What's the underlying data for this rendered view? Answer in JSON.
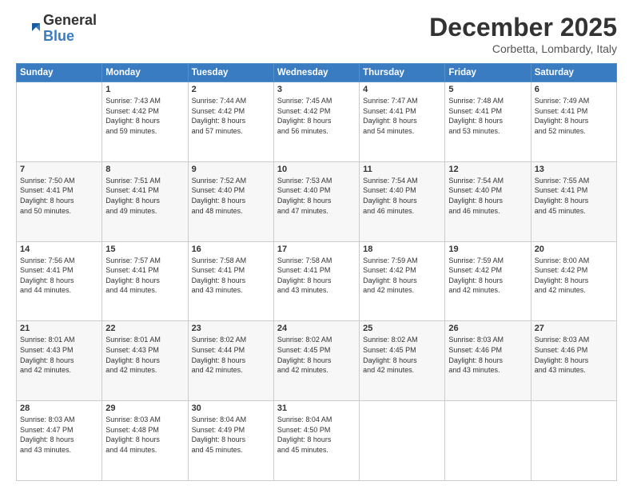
{
  "header": {
    "logo_general": "General",
    "logo_blue": "Blue",
    "month_title": "December 2025",
    "location": "Corbetta, Lombardy, Italy"
  },
  "days_of_week": [
    "Sunday",
    "Monday",
    "Tuesday",
    "Wednesday",
    "Thursday",
    "Friday",
    "Saturday"
  ],
  "weeks": [
    [
      {
        "day": "",
        "content": ""
      },
      {
        "day": "1",
        "content": "Sunrise: 7:43 AM\nSunset: 4:42 PM\nDaylight: 8 hours\nand 59 minutes."
      },
      {
        "day": "2",
        "content": "Sunrise: 7:44 AM\nSunset: 4:42 PM\nDaylight: 8 hours\nand 57 minutes."
      },
      {
        "day": "3",
        "content": "Sunrise: 7:45 AM\nSunset: 4:42 PM\nDaylight: 8 hours\nand 56 minutes."
      },
      {
        "day": "4",
        "content": "Sunrise: 7:47 AM\nSunset: 4:41 PM\nDaylight: 8 hours\nand 54 minutes."
      },
      {
        "day": "5",
        "content": "Sunrise: 7:48 AM\nSunset: 4:41 PM\nDaylight: 8 hours\nand 53 minutes."
      },
      {
        "day": "6",
        "content": "Sunrise: 7:49 AM\nSunset: 4:41 PM\nDaylight: 8 hours\nand 52 minutes."
      }
    ],
    [
      {
        "day": "7",
        "content": "Sunrise: 7:50 AM\nSunset: 4:41 PM\nDaylight: 8 hours\nand 50 minutes."
      },
      {
        "day": "8",
        "content": "Sunrise: 7:51 AM\nSunset: 4:41 PM\nDaylight: 8 hours\nand 49 minutes."
      },
      {
        "day": "9",
        "content": "Sunrise: 7:52 AM\nSunset: 4:40 PM\nDaylight: 8 hours\nand 48 minutes."
      },
      {
        "day": "10",
        "content": "Sunrise: 7:53 AM\nSunset: 4:40 PM\nDaylight: 8 hours\nand 47 minutes."
      },
      {
        "day": "11",
        "content": "Sunrise: 7:54 AM\nSunset: 4:40 PM\nDaylight: 8 hours\nand 46 minutes."
      },
      {
        "day": "12",
        "content": "Sunrise: 7:54 AM\nSunset: 4:40 PM\nDaylight: 8 hours\nand 46 minutes."
      },
      {
        "day": "13",
        "content": "Sunrise: 7:55 AM\nSunset: 4:41 PM\nDaylight: 8 hours\nand 45 minutes."
      }
    ],
    [
      {
        "day": "14",
        "content": "Sunrise: 7:56 AM\nSunset: 4:41 PM\nDaylight: 8 hours\nand 44 minutes."
      },
      {
        "day": "15",
        "content": "Sunrise: 7:57 AM\nSunset: 4:41 PM\nDaylight: 8 hours\nand 44 minutes."
      },
      {
        "day": "16",
        "content": "Sunrise: 7:58 AM\nSunset: 4:41 PM\nDaylight: 8 hours\nand 43 minutes."
      },
      {
        "day": "17",
        "content": "Sunrise: 7:58 AM\nSunset: 4:41 PM\nDaylight: 8 hours\nand 43 minutes."
      },
      {
        "day": "18",
        "content": "Sunrise: 7:59 AM\nSunset: 4:42 PM\nDaylight: 8 hours\nand 42 minutes."
      },
      {
        "day": "19",
        "content": "Sunrise: 7:59 AM\nSunset: 4:42 PM\nDaylight: 8 hours\nand 42 minutes."
      },
      {
        "day": "20",
        "content": "Sunrise: 8:00 AM\nSunset: 4:42 PM\nDaylight: 8 hours\nand 42 minutes."
      }
    ],
    [
      {
        "day": "21",
        "content": "Sunrise: 8:01 AM\nSunset: 4:43 PM\nDaylight: 8 hours\nand 42 minutes."
      },
      {
        "day": "22",
        "content": "Sunrise: 8:01 AM\nSunset: 4:43 PM\nDaylight: 8 hours\nand 42 minutes."
      },
      {
        "day": "23",
        "content": "Sunrise: 8:02 AM\nSunset: 4:44 PM\nDaylight: 8 hours\nand 42 minutes."
      },
      {
        "day": "24",
        "content": "Sunrise: 8:02 AM\nSunset: 4:45 PM\nDaylight: 8 hours\nand 42 minutes."
      },
      {
        "day": "25",
        "content": "Sunrise: 8:02 AM\nSunset: 4:45 PM\nDaylight: 8 hours\nand 42 minutes."
      },
      {
        "day": "26",
        "content": "Sunrise: 8:03 AM\nSunset: 4:46 PM\nDaylight: 8 hours\nand 43 minutes."
      },
      {
        "day": "27",
        "content": "Sunrise: 8:03 AM\nSunset: 4:46 PM\nDaylight: 8 hours\nand 43 minutes."
      }
    ],
    [
      {
        "day": "28",
        "content": "Sunrise: 8:03 AM\nSunset: 4:47 PM\nDaylight: 8 hours\nand 43 minutes."
      },
      {
        "day": "29",
        "content": "Sunrise: 8:03 AM\nSunset: 4:48 PM\nDaylight: 8 hours\nand 44 minutes."
      },
      {
        "day": "30",
        "content": "Sunrise: 8:04 AM\nSunset: 4:49 PM\nDaylight: 8 hours\nand 45 minutes."
      },
      {
        "day": "31",
        "content": "Sunrise: 8:04 AM\nSunset: 4:50 PM\nDaylight: 8 hours\nand 45 minutes."
      },
      {
        "day": "",
        "content": ""
      },
      {
        "day": "",
        "content": ""
      },
      {
        "day": "",
        "content": ""
      }
    ]
  ]
}
